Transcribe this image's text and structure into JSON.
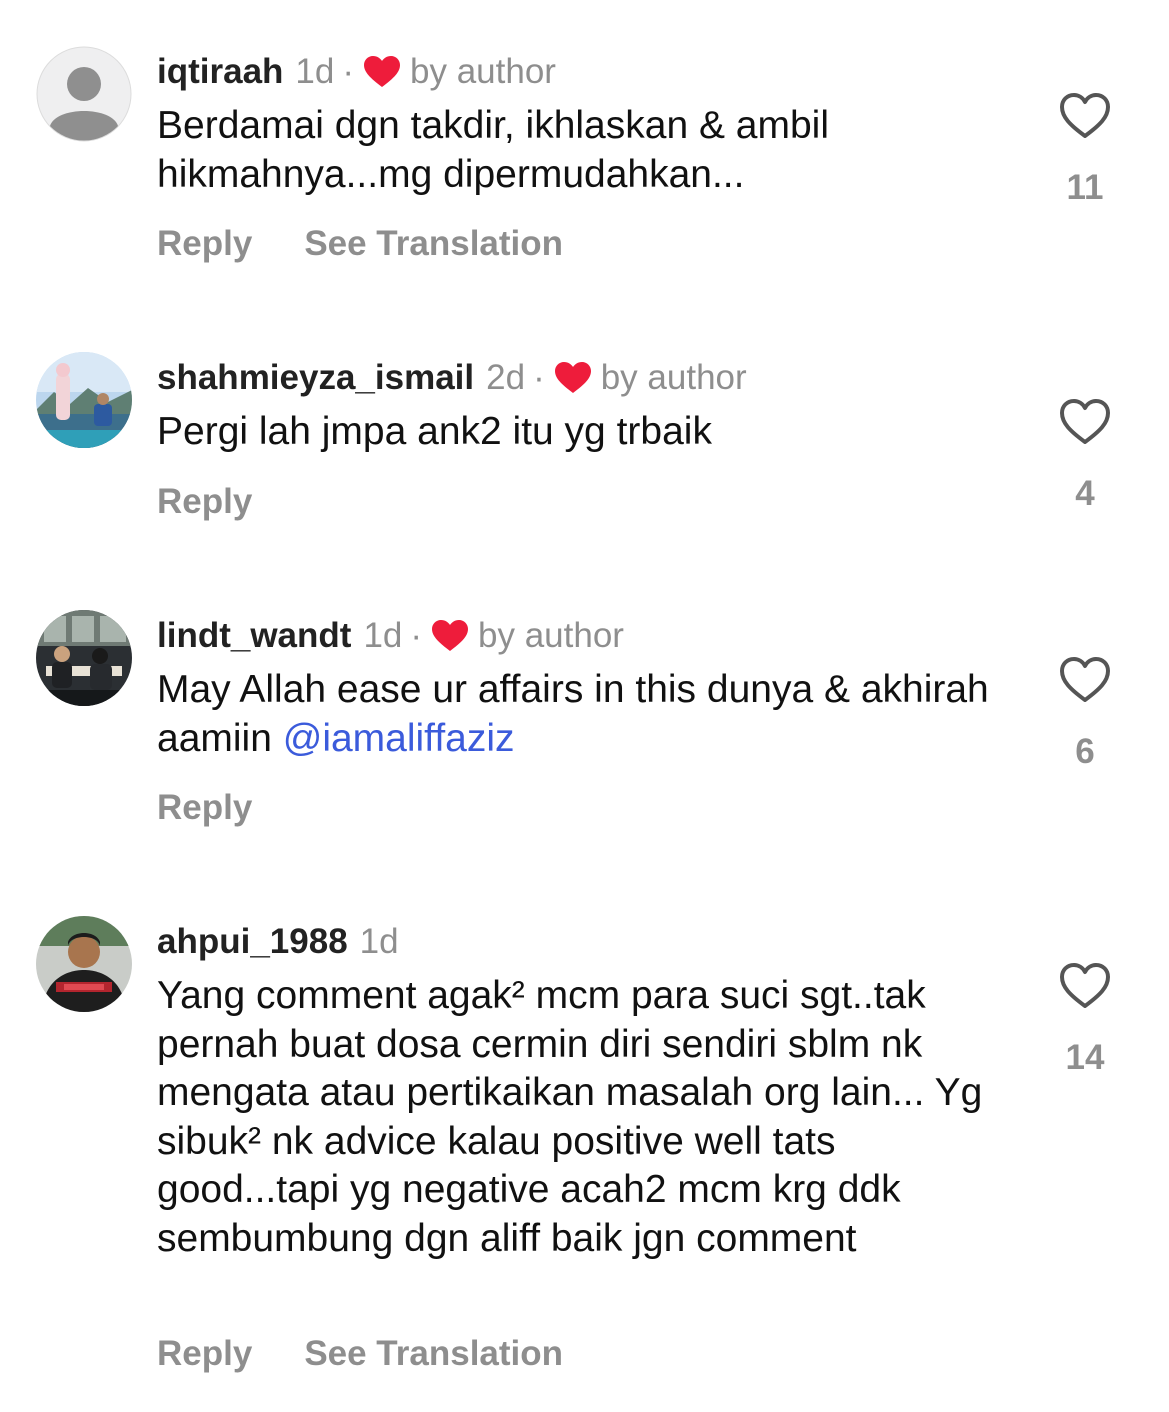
{
  "comments": [
    {
      "username": "iqtiraah",
      "time": "1d",
      "separator": "·",
      "author_liked": true,
      "author_label": "by author",
      "text": "Berdamai dgn takdir, ikhlaskan & ambil hikmahnya...mg dipermudahkan...",
      "reply_label": "Reply",
      "translation_label": "See Translation",
      "like_count": "11",
      "avatar": "default-avatar-icon"
    },
    {
      "username": "shahmieyza_ismail",
      "time": "2d",
      "separator": "·",
      "author_liked": true,
      "author_label": "by author",
      "text": "Pergi lah jmpa ank2 itu yg trbaik",
      "reply_label": "Reply",
      "like_count": "4",
      "avatar": "photo-avatar"
    },
    {
      "username": "lindt_wandt",
      "time": "1d",
      "separator": "·",
      "author_liked": true,
      "author_label": "by author",
      "text_before": "May Allah ease ur affairs in this dunya & akhirah aamiin ",
      "mention": "@iamaliffaziz",
      "reply_label": "Reply",
      "like_count": "6",
      "avatar": "photo-avatar"
    },
    {
      "username": "ahpui_1988",
      "time": "1d",
      "author_liked": false,
      "text": "Yang comment agak² mcm para suci sgt..tak pernah buat dosa cermin diri sendiri sblm nk mengata atau pertikaikan masalah org lain... Yg sibuk² nk advice kalau positive well tats good...tapi yg negative acah2 mcm krg ddk sembumbung dgn aliff baik jgn comment",
      "reply_label": "Reply",
      "translation_label": "See Translation",
      "like_count": "14",
      "avatar": "photo-avatar"
    }
  ],
  "colors": {
    "heart_red": "#ee1c3b",
    "muted_gray": "#8e8e8e",
    "mention_blue": "#3b5bdb",
    "text": "#111111"
  },
  "icons": {
    "author_like": "heart-filled-icon",
    "like_button": "heart-outline-icon"
  }
}
